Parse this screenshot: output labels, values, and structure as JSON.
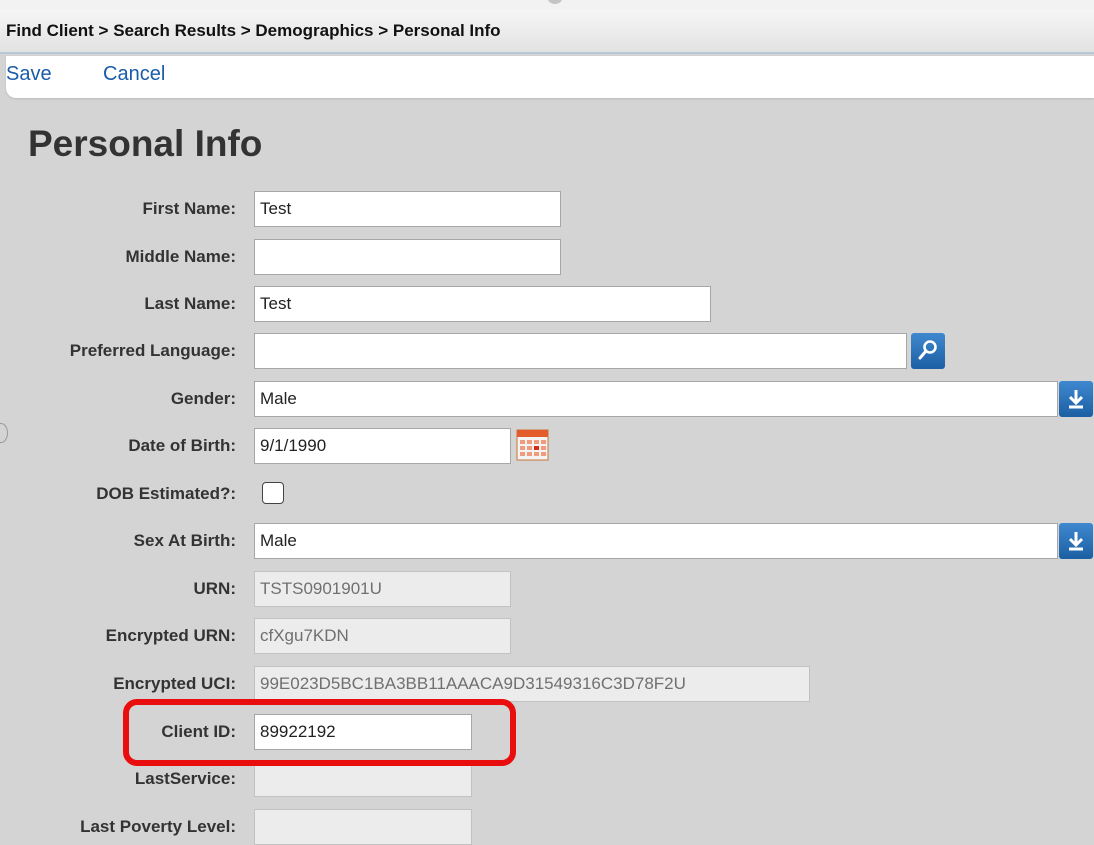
{
  "breadcrumb": "Find Client > Search Results > Demographics > Personal Info",
  "actions": {
    "save": "Save",
    "cancel": "Cancel"
  },
  "page_title": "Personal Info",
  "fields": {
    "first_name": {
      "label": "First Name:",
      "value": "Test"
    },
    "middle_name": {
      "label": "Middle Name:",
      "value": ""
    },
    "last_name": {
      "label": "Last Name:",
      "value": "Test"
    },
    "preferred_language": {
      "label": "Preferred Language:",
      "value": "",
      "button_icon": "search-icon"
    },
    "gender": {
      "label": "Gender:",
      "value": "Male",
      "button_icon": "dropdown-arrow-icon"
    },
    "date_of_birth": {
      "label": "Date of Birth:",
      "value": "9/1/1990",
      "button_icon": "calendar-icon"
    },
    "dob_estimated": {
      "label": "DOB Estimated?:",
      "checked": false
    },
    "sex_at_birth": {
      "label": "Sex At Birth:",
      "value": "Male",
      "button_icon": "dropdown-arrow-icon"
    },
    "urn": {
      "label": "URN:",
      "value": "TSTS0901901U"
    },
    "encrypted_urn": {
      "label": "Encrypted URN:",
      "value": "cfXgu7KDN"
    },
    "encrypted_uci": {
      "label": "Encrypted UCI:",
      "value": "99E023D5BC1BA3BB11AAACA9D31549316C3D78F2U"
    },
    "client_id": {
      "label": "Client ID:",
      "value": "89922192"
    },
    "last_service": {
      "label": "LastService:",
      "value": ""
    },
    "last_poverty_level": {
      "label": "Last Poverty Level:",
      "value": ""
    }
  },
  "colors": {
    "link": "#1a5ca9",
    "highlight": "#ea0d0d",
    "button": "#1c5fa3",
    "background": "#d4d4d4"
  }
}
